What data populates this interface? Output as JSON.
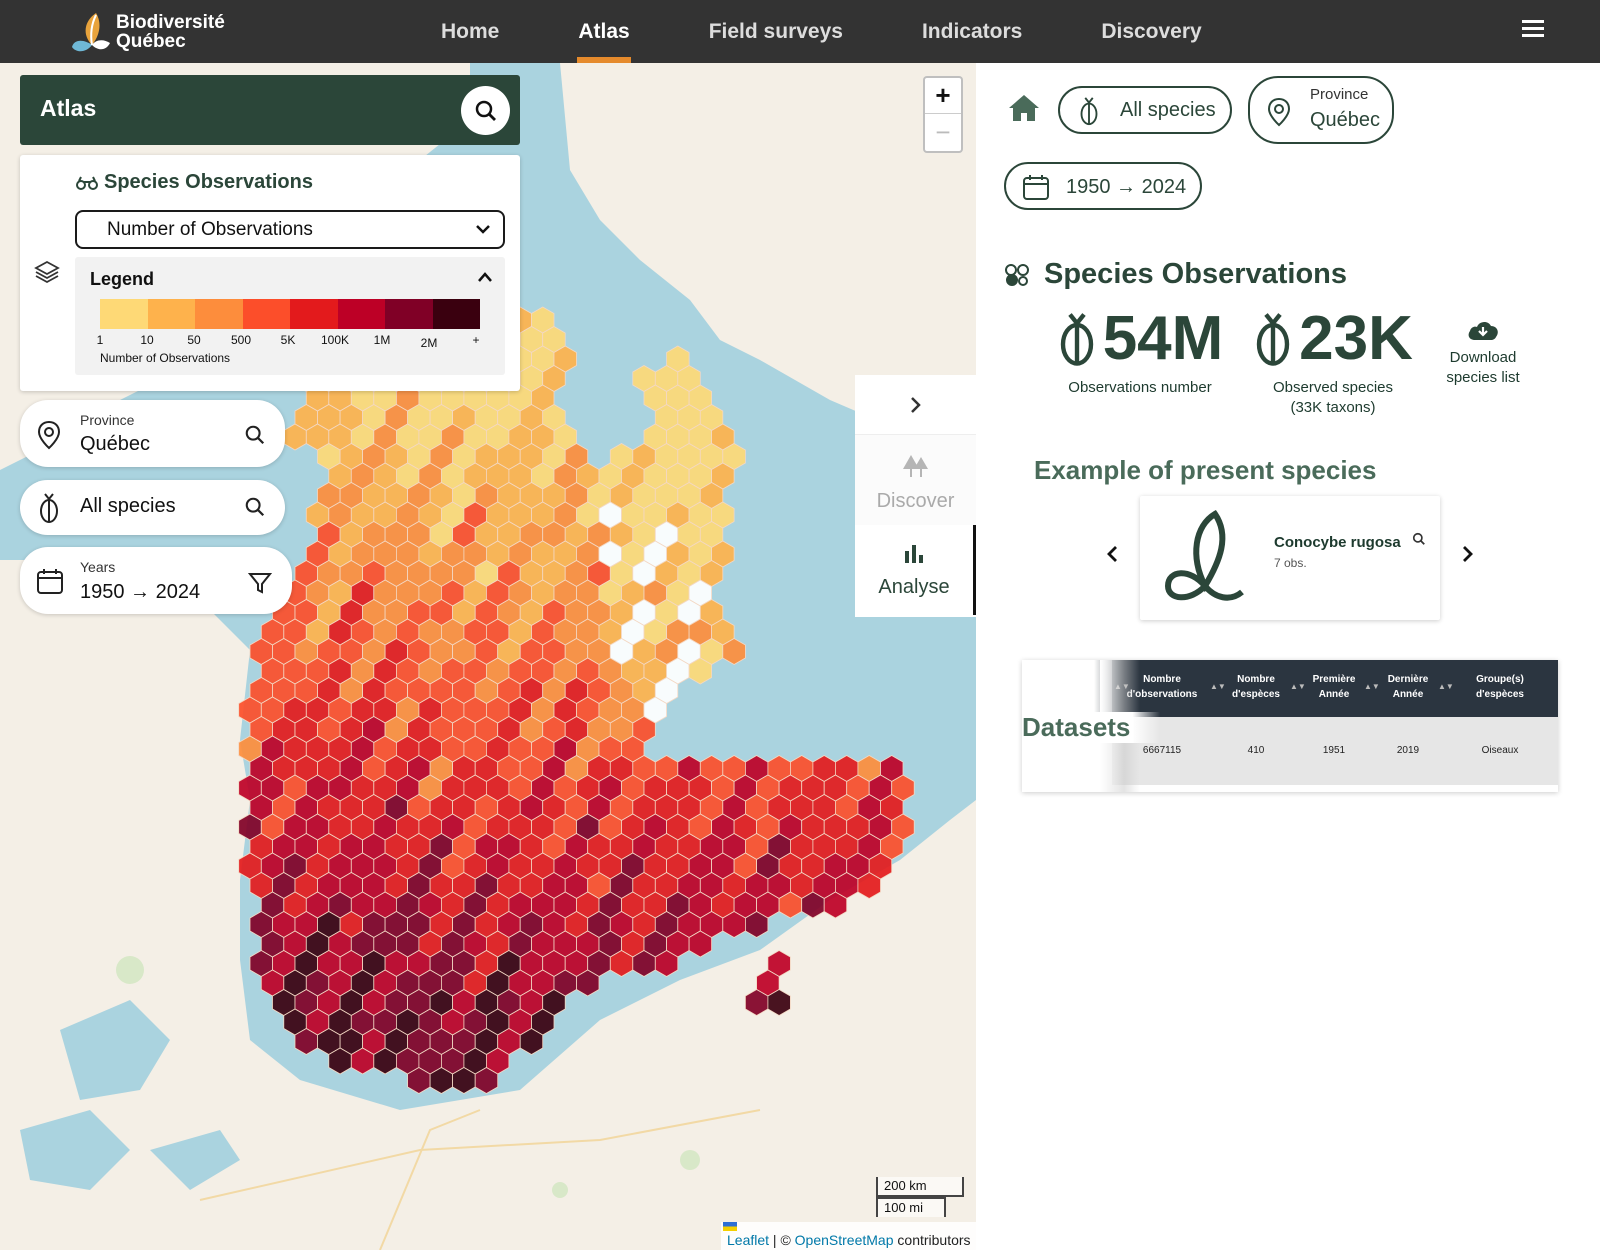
{
  "header": {
    "logo_line1": "Biodiversité",
    "logo_line2": "Québec",
    "nav": [
      {
        "label": "Home",
        "active": false
      },
      {
        "label": "Atlas",
        "active": true
      },
      {
        "label": "Field surveys",
        "active": false
      },
      {
        "label": "Indicators",
        "active": false
      },
      {
        "label": "Discovery",
        "active": false
      }
    ]
  },
  "sidebar": {
    "title": "Atlas",
    "layer": {
      "title": "Species Observations",
      "selected": "Number of Observations"
    },
    "legend": {
      "title": "Legend",
      "ticks": [
        "1",
        "10",
        "50",
        "500",
        "5K",
        "100K",
        "1M",
        "2M",
        "+"
      ],
      "colors": [
        "#fed976",
        "#feb24c",
        "#fd8d3c",
        "#fc4e2a",
        "#e31a1c",
        "#bd0026",
        "#800026",
        "#3a000f"
      ],
      "subtitle": "Number of Observations"
    },
    "filters": {
      "province_label": "Province",
      "province_value": "Québec",
      "species_value": "All species",
      "years_label": "Years",
      "years_value": "1950 → 2024"
    }
  },
  "map": {
    "tabs": {
      "discover": "Discover",
      "analyse": "Analyse"
    },
    "scale_km": "200 km",
    "scale_mi": "100 mi",
    "attribution": {
      "leaflet": "Leaflet",
      "sep": " | © ",
      "osm": "OpenStreetMap",
      "contrib": " contributors"
    }
  },
  "panel": {
    "chips": {
      "species": "All species",
      "province_label": "Province",
      "province_value": "Québec",
      "years": "1950 → 2024"
    },
    "heading": "Species Observations",
    "stats": [
      {
        "value": "54M",
        "caption": "Observations number"
      },
      {
        "value": "23K",
        "caption": "Observed species",
        "caption2": "(33K taxons)"
      }
    ],
    "download": {
      "line1": "Download",
      "line2": "species list"
    },
    "example_title": "Example of present species",
    "example_species": {
      "name": "Conocybe rugosa",
      "obs": "7 obs."
    },
    "datasets": {
      "title": "Datasets",
      "columns": [
        {
          "l1": "Nombre",
          "l2": "d'observations"
        },
        {
          "l1": "Nombre",
          "l2": "d'espèces"
        },
        {
          "l1": "Première",
          "l2": "Année"
        },
        {
          "l1": "Dernière",
          "l2": "Année"
        },
        {
          "l1": "Groupe(s)",
          "l2": "d'espèces"
        }
      ],
      "rows": [
        [
          "6667115",
          "410",
          "1951",
          "2019",
          "Oiseaux"
        ]
      ]
    }
  },
  "colors": {
    "nav_bg": "#333333",
    "accent": "#e58a2c",
    "primary": "#2b4639"
  }
}
